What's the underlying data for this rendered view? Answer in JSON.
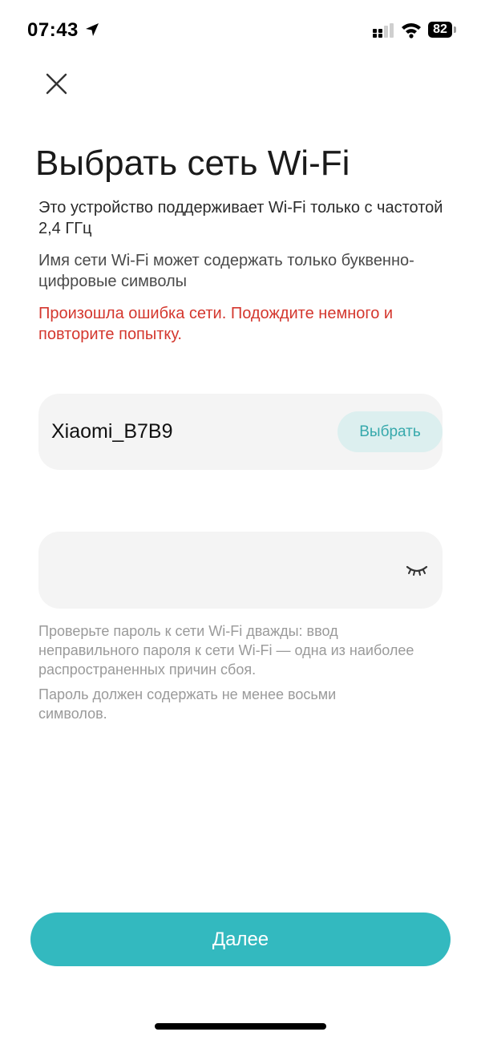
{
  "status_bar": {
    "time": "07:43",
    "battery": "82",
    "icons": [
      "location-arrow-icon",
      "cellular-signal-icon",
      "wifi-icon",
      "battery-icon"
    ]
  },
  "header": {
    "close_icon": "close-icon",
    "title": "Выбрать сеть Wi-Fi"
  },
  "info": {
    "frequency_note": "Это устройство поддерживает Wi-Fi только с частотой 2,4 ГГц",
    "name_note": "Имя сети Wi-Fi может содержать только буквенно-цифровые символы",
    "error": "Произошла ошибка сети. Подождите немного и повторите попытку."
  },
  "network": {
    "name": "Xiaomi_B7B9",
    "select_label": "Выбрать"
  },
  "password": {
    "value": "",
    "toggle_icon": "eye-closed-icon"
  },
  "hints": {
    "check_password": "Проверьте пароль к сети Wi-Fi дважды: ввод неправильного пароля к сети Wi-Fi — одна из наиболее распространенных причин сбоя.",
    "min_length": "Пароль должен содержать не менее восьми символов."
  },
  "actions": {
    "next_label": "Далее"
  },
  "colors": {
    "accent": "#33b9bf",
    "accent_soft": "#dcefef",
    "error": "#d4372e",
    "field_bg": "#f4f4f4",
    "hint": "#9a9a9a"
  }
}
